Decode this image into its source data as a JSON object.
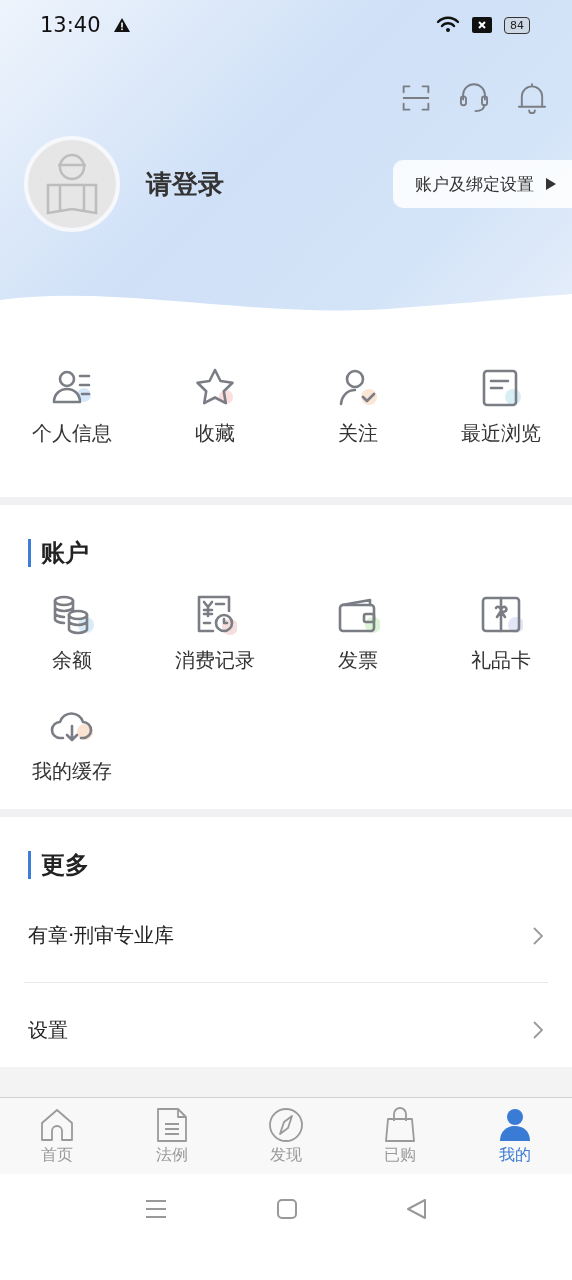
{
  "status_bar": {
    "time": "13:40",
    "battery": "84"
  },
  "profile": {
    "name": "请登录",
    "settings_button": "账户及绑定设置"
  },
  "quick_actions": [
    {
      "label": "个人信息"
    },
    {
      "label": "收藏"
    },
    {
      "label": "关注"
    },
    {
      "label": "最近浏览"
    }
  ],
  "account": {
    "title": "账户",
    "items": [
      {
        "label": "余额"
      },
      {
        "label": "消费记录"
      },
      {
        "label": "发票"
      },
      {
        "label": "礼品卡"
      },
      {
        "label": "我的缓存"
      }
    ]
  },
  "more": {
    "title": "更多",
    "items": [
      {
        "label": "有章·刑审专业库"
      },
      {
        "label": "设置"
      }
    ]
  },
  "tabs": [
    {
      "label": "首页",
      "selected": false
    },
    {
      "label": "法例",
      "selected": false
    },
    {
      "label": "发现",
      "selected": false
    },
    {
      "label": "已购",
      "selected": false
    },
    {
      "label": "我的",
      "selected": true
    }
  ]
}
